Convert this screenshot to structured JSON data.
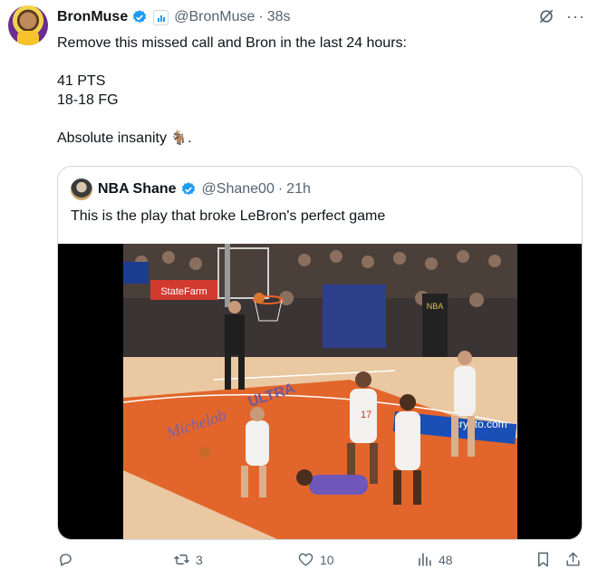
{
  "tweet": {
    "author_name": "BronMuse",
    "handle": "@BronMuse",
    "separator": "·",
    "time": "38s",
    "more": "···",
    "lines": [
      "Remove this missed call and Bron in the last 24 hours:",
      "41 PTS",
      "18-18 FG",
      "Absolute insanity"
    ],
    "emoji": "🐐",
    "emoji_suffix": "."
  },
  "quote": {
    "author_name": "NBA Shane",
    "handle": "@Shane00",
    "separator": "·",
    "time": "21h",
    "text": "This is the play that broke LeBron's perfect game",
    "media": {
      "sign_statefarm": "StateFarm",
      "sign_nba": "NBA",
      "floor_michelob": "Michelob",
      "floor_ultra": "ULTRA",
      "floor_crypto": "crypto.com",
      "jersey_17": "17"
    }
  },
  "actions": {
    "reply_count": "",
    "retweet_count": "3",
    "like_count": "10",
    "views_count": "48"
  },
  "colors": {
    "verified": "#1d9bf0",
    "muted": "#536471",
    "border": "#cfd9de",
    "court_orange": "#e2662c",
    "court_wood": "#e9c8a2"
  }
}
